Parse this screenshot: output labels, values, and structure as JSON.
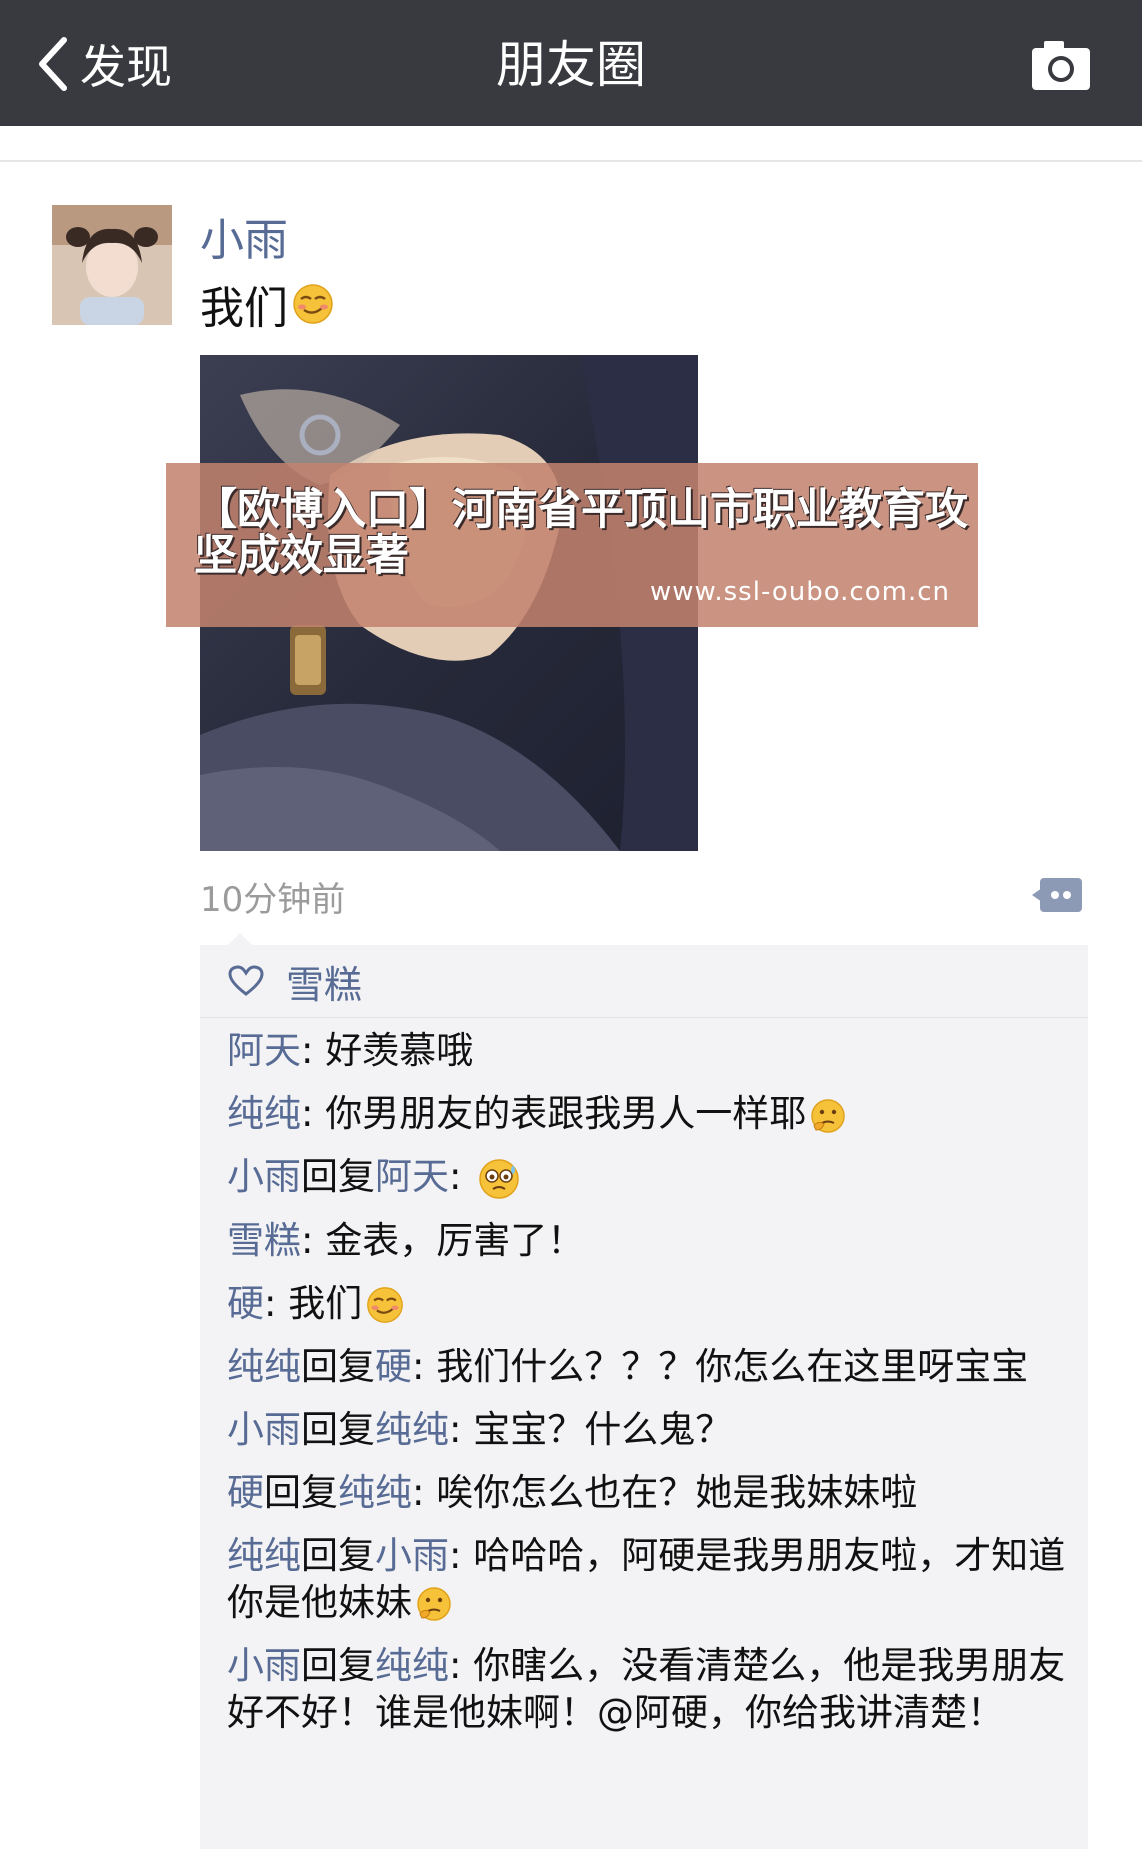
{
  "nav": {
    "back_label": "发现",
    "title": "朋友圈"
  },
  "post": {
    "user_name": "小雨",
    "text": "我们",
    "time": "10分钟前",
    "likes": [
      "雪糕"
    ]
  },
  "ad": {
    "title": "【欧博入口】河南省平顶山市职业教育攻坚成效显著",
    "url": "www.ssl-oubo.com.cn"
  },
  "comments": [
    {
      "from": "阿天",
      "text": "好羡慕哦"
    },
    {
      "from": "纯纯",
      "text": "你男朋友的表跟我男人一样耶",
      "emoji": "thinking-emoji"
    },
    {
      "from": "小雨",
      "reply_word": "回复",
      "to": "阿天",
      "text": "",
      "emoji": "sweat-emoji"
    },
    {
      "from": "雪糕",
      "text": "金表，厉害了！"
    },
    {
      "from": "硬",
      "text": "我们",
      "emoji": "smug-emoji"
    },
    {
      "from": "纯纯",
      "reply_word": "回复",
      "to": "硬",
      "text": "我们什么？？？你怎么在这里呀宝宝"
    },
    {
      "from": "小雨",
      "reply_word": "回复",
      "to": "纯纯",
      "text": "宝宝？什么鬼？"
    },
    {
      "from": "硬",
      "reply_word": "回复",
      "to": "纯纯",
      "text": "唉你怎么也在？她是我妹妹啦"
    },
    {
      "from": "纯纯",
      "reply_word": "回复",
      "to": "小雨",
      "text": "哈哈哈，阿硬是我男朋友啦，才知道你是他妹妹",
      "emoji": "thinking-emoji"
    },
    {
      "from": "小雨",
      "reply_word": "回复",
      "to": "纯纯",
      "text": "你瞎么，没看清楚么，他是我男朋友好不好！谁是他妹啊！@阿硬，你给我讲清楚！"
    }
  ],
  "colors": {
    "navbar": "#393a3f",
    "link_name": "#576b95",
    "comment_bg": "#f3f3f5",
    "ad_bg": "#c3826e"
  }
}
